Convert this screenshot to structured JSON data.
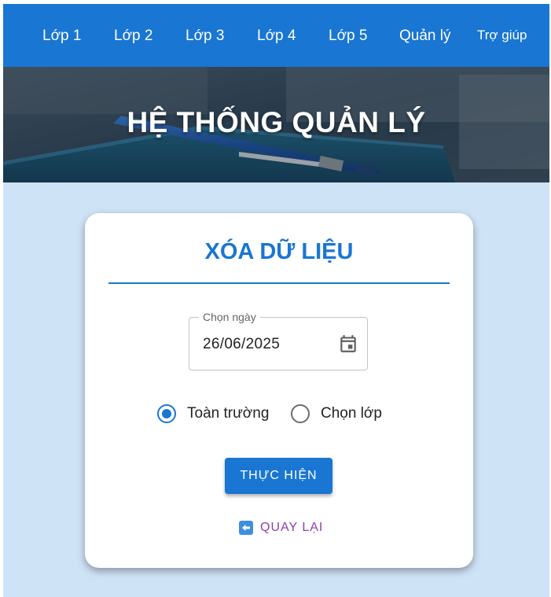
{
  "navbar": {
    "items": [
      {
        "label": "Lớp 1"
      },
      {
        "label": "Lớp 2"
      },
      {
        "label": "Lớp 3"
      },
      {
        "label": "Lớp 4"
      },
      {
        "label": "Lớp 5"
      },
      {
        "label": "Quản lý"
      },
      {
        "label": "Trợ giúp"
      }
    ]
  },
  "hero": {
    "title": "HỆ THỐNG QUẢN LÝ"
  },
  "card": {
    "title": "XÓA DỮ LIỆU",
    "date_field": {
      "label": "Chọn ngày",
      "value": "26/06/2025",
      "icon": "calendar-icon"
    },
    "scope_options": [
      {
        "label": "Toàn trường",
        "selected": true
      },
      {
        "label": "Chọn lớp",
        "selected": false
      }
    ],
    "submit_label": "THỰC HIỆN",
    "back_label": "QUAY LẠI",
    "back_icon": "arrow-left-icon"
  },
  "colors": {
    "primary": "#1976d2",
    "page_background": "#cfe3f7",
    "back_link": "#8e3fa8"
  }
}
